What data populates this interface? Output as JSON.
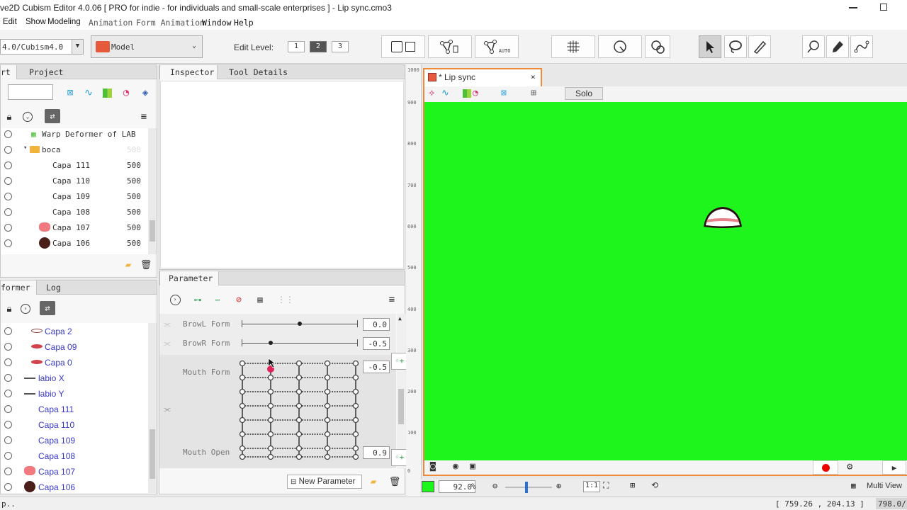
{
  "window": {
    "title": "ve2D Cubism Editor 4.0.06   [ PRO for indie - for individuals and small-scale enterprises ]  - Lip sync.cmo3"
  },
  "menu": [
    "Edit",
    "Show",
    "Modeling",
    "Animation",
    "Form Animation",
    "Window",
    "Help"
  ],
  "toolbar": {
    "version_combo": "4.0/Cubism4.0",
    "mode_combo": "Model",
    "edit_level_label": "Edit Level:",
    "edit_levels": [
      "1",
      "2",
      "3"
    ],
    "edit_level_selected": "2",
    "auto_label": "AUTO"
  },
  "left_top": {
    "tabs": [
      "rt",
      "Project"
    ],
    "items": [
      {
        "label": "Warp Deformer of LAB",
        "value": "",
        "kind": "warp"
      },
      {
        "label": "boca",
        "value": "500",
        "kind": "folder"
      },
      {
        "label": "Capa 111",
        "value": "500",
        "kind": "layer"
      },
      {
        "label": "Capa 110",
        "value": "500",
        "kind": "layer"
      },
      {
        "label": "Capa 109",
        "value": "500",
        "kind": "layer"
      },
      {
        "label": "Capa 108",
        "value": "500",
        "kind": "layer"
      },
      {
        "label": "Capa 107",
        "value": "500",
        "kind": "pink"
      },
      {
        "label": "Capa 106",
        "value": "500",
        "kind": "dark"
      }
    ]
  },
  "left_bottom": {
    "tabs": [
      "former",
      "Log"
    ],
    "items": [
      {
        "label": "Capa 2",
        "kind": "lip-outline"
      },
      {
        "label": "Capa 09",
        "kind": "lip-red"
      },
      {
        "label": "Capa 0",
        "kind": "lip-red"
      },
      {
        "label": "labio X",
        "kind": "line"
      },
      {
        "label": "labio Y",
        "kind": "line"
      },
      {
        "label": "Capa 111",
        "kind": "none"
      },
      {
        "label": "Capa 110",
        "kind": "none"
      },
      {
        "label": "Capa 109",
        "kind": "none"
      },
      {
        "label": "Capa 108",
        "kind": "none"
      },
      {
        "label": "Capa 107",
        "kind": "pink"
      },
      {
        "label": "Capa 106",
        "kind": "dark"
      }
    ]
  },
  "inspector": {
    "tabs": [
      "Inspector",
      "Tool Details"
    ]
  },
  "parameter": {
    "tab": "Parameter",
    "rows": [
      {
        "name": "BrowL Form",
        "value": "0.0",
        "level": 0.5
      },
      {
        "name": "BrowR Form",
        "value": "-0.5",
        "level": 0.25
      }
    ],
    "mouth_form": {
      "name": "Mouth Form",
      "value": "-0.5"
    },
    "mouth_open": {
      "name": "Mouth Open",
      "value": "0.9"
    },
    "new_parameter": "New Parameter"
  },
  "viewport": {
    "tab_title": "* Lip sync",
    "solo_label": "Solo",
    "background": "#1df51d",
    "ruler_marks": [
      "1000",
      "900",
      "800",
      "700",
      "600",
      "500",
      "400",
      "300",
      "200",
      "100",
      "0"
    ],
    "zoom": "92.0",
    "zoom_unit": "%",
    "ratio_label": "1:1",
    "multi_view": "Multi View"
  },
  "status": {
    "left": "p..",
    "coords": "[   759.26  ,   204.13  ]",
    "right": "798.0/"
  }
}
